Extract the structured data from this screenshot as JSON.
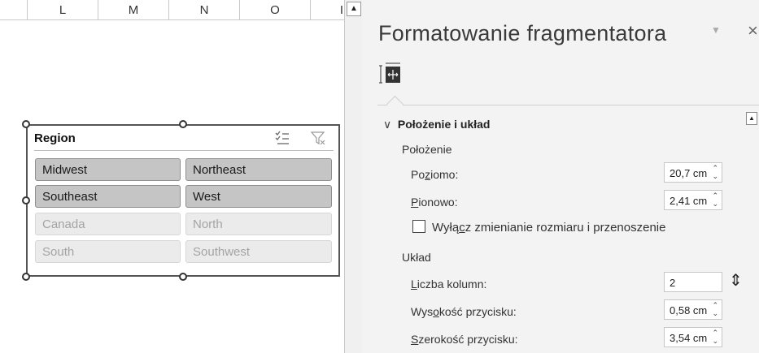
{
  "sheet": {
    "columns": [
      "L",
      "M",
      "N",
      "O",
      "I"
    ]
  },
  "slicer": {
    "title": "Region",
    "items": [
      {
        "label": "Midwest",
        "state": "selected"
      },
      {
        "label": "Northeast",
        "state": "selected"
      },
      {
        "label": "Southeast",
        "state": "selected"
      },
      {
        "label": "West",
        "state": "selected"
      },
      {
        "label": "Canada",
        "state": "nodata"
      },
      {
        "label": "North",
        "state": "nodata"
      },
      {
        "label": "South",
        "state": "nodata"
      },
      {
        "label": "Southwest",
        "state": "nodata"
      }
    ],
    "icons": [
      "multi-select-icon",
      "clear-filter-icon"
    ]
  },
  "pane": {
    "title": "Formatowanie fragmentatora",
    "tab_icon": "size-properties-icon",
    "section": "Położenie i układ",
    "group_position": "Położenie",
    "horizontal": {
      "label_pre": "Po",
      "label_ul": "z",
      "label_post": "iomo:",
      "value": "20,7 cm"
    },
    "vertical": {
      "label_pre": "",
      "label_ul": "P",
      "label_post": "ionowo:",
      "value": "2,41 cm"
    },
    "checkbox": {
      "pre": "Wyłą",
      "ul": "c",
      "post": "z zmienianie rozmiaru i przenoszenie",
      "checked": false
    },
    "group_layout": "Układ",
    "columns": {
      "label_pre": "",
      "label_ul": "L",
      "label_post": "iczba kolumn:",
      "value": "2"
    },
    "button_height": {
      "label_pre": "Wys",
      "label_ul": "o",
      "label_post": "kość przycisku:",
      "value": "0,58 cm"
    },
    "button_width": {
      "label_pre": "",
      "label_ul": "S",
      "label_post": "zerokość przycisku:",
      "value": "3,54 cm"
    }
  }
}
